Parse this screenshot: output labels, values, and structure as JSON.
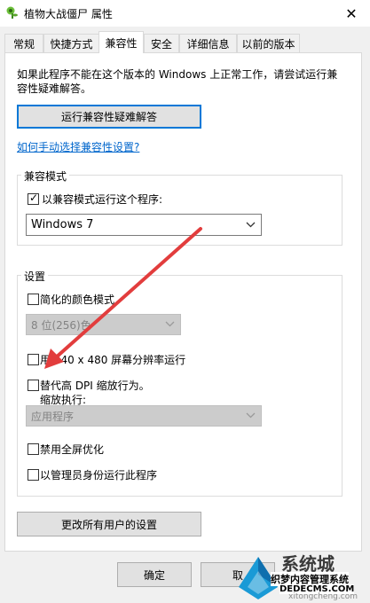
{
  "window": {
    "title": "植物大战僵尸 属性",
    "close_glyph": "✕"
  },
  "tabs": [
    {
      "label": "常规",
      "active": false
    },
    {
      "label": "快捷方式",
      "active": false
    },
    {
      "label": "兼容性",
      "active": true
    },
    {
      "label": "安全",
      "active": false
    },
    {
      "label": "详细信息",
      "active": false
    },
    {
      "label": "以前的版本",
      "active": false
    }
  ],
  "intro": {
    "line1": "如果此程序不能在这个版本的 Windows 上正常工作，请尝试运行兼",
    "line2": "容性疑难解答。"
  },
  "troubleshoot_button": "运行兼容性疑难解答",
  "manual_link": "如何手动选择兼容性设置?",
  "compat_mode": {
    "group_label": "兼容模式",
    "checkbox_label": "以兼容模式运行这个程序:",
    "checked": true,
    "selected_os": "Windows 7"
  },
  "settings": {
    "group_label": "设置",
    "reduced_color": {
      "label": "简化的颜色模式",
      "checked": false
    },
    "color_select": "8 位(256)色",
    "run_640": {
      "label": "用 640 x 480 屏幕分辨率运行",
      "checked": false
    },
    "dpi_override": {
      "label": "替代高 DPI 缩放行为。",
      "checked": false
    },
    "scaling_label": "缩放执行:",
    "scaling_select": "应用程序",
    "disable_fullscreen": {
      "label": "禁用全屏优化",
      "checked": false
    },
    "run_as_admin": {
      "label": "以管理员身份运行此程序",
      "checked": false
    }
  },
  "all_users_button": "更改所有用户的设置",
  "footer": {
    "ok": "确定",
    "cancel": "取"
  },
  "watermark": {
    "brand": "系统城",
    "caption": "织梦内容管理系统",
    "domain": "DEDECMS.COM",
    "site": "xitongcheng.com"
  },
  "colors": {
    "accent": "#0078d7",
    "link": "#0066cc",
    "arrow": "#e23d3d"
  },
  "icons": {
    "app": "plant-icon",
    "close": "close-icon",
    "check": "checkmark-icon",
    "chevron": "chevron-down-icon"
  }
}
